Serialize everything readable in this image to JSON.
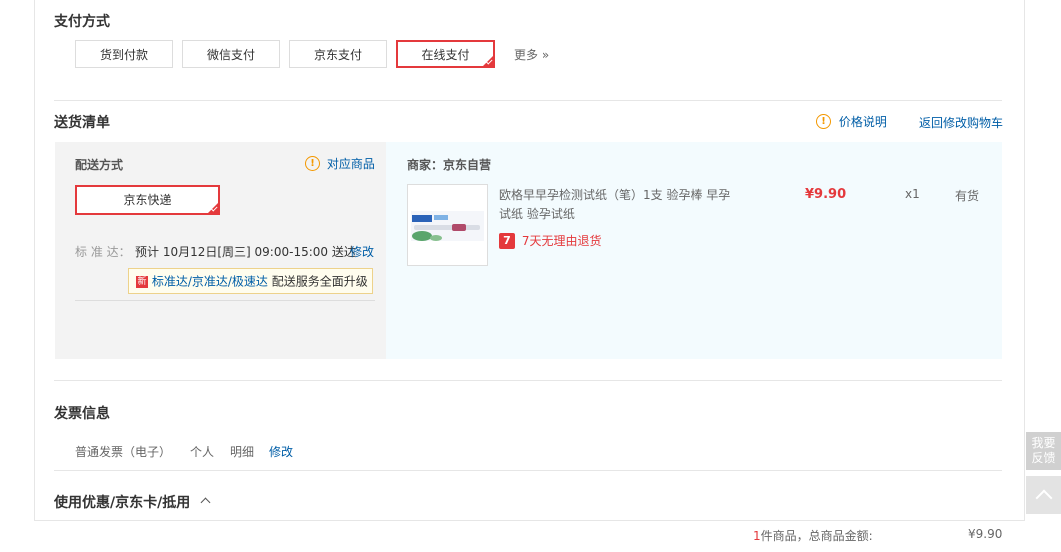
{
  "payment": {
    "title": "支付方式",
    "options": [
      "货到付款",
      "微信支付",
      "京东支付",
      "在线支付"
    ],
    "selected": "在线支付",
    "more": "更多 »"
  },
  "shipping_list": {
    "title": "送货清单",
    "price_note": "价格说明",
    "back_to_cart": "返回修改购物车"
  },
  "delivery": {
    "method_label": "配送方式",
    "matching_goods": "对应商品",
    "selected_method": "京东快递",
    "standard_label": "标 准 达：",
    "standard_value": "预计 10月12日[周三] 09:00-15:00 送达",
    "modify": "修改",
    "tip_badge": "新",
    "tip_link": "标准达/京准达/极速达",
    "tip_text": "配送服务全面升级"
  },
  "merchant": {
    "label": "商家：京东自营"
  },
  "product": {
    "name_line1": "欧格早早孕检测试纸（笔）1支 验孕棒 早孕",
    "name_line2": "试纸 验孕试纸",
    "return_badge": "7",
    "return_policy": "7天无理由退货",
    "price": "¥9.90",
    "qty": "x1",
    "stock": "有货"
  },
  "invoice": {
    "title": "发票信息",
    "type": "普通发票（电子）",
    "holder": "个人",
    "content": "明细",
    "modify": "修改"
  },
  "coupon": {
    "title": "使用优惠/京东卡/抵用"
  },
  "summary": {
    "count": "1",
    "count_suffix": "件商品，总商品金额:",
    "total": "¥9.90"
  },
  "side": {
    "feedback_line1": "我要",
    "feedback_line2": "反馈"
  },
  "colors": {
    "accent_red": "#e4393c",
    "link_blue": "#005ea7",
    "warn_orange": "#f39800"
  }
}
